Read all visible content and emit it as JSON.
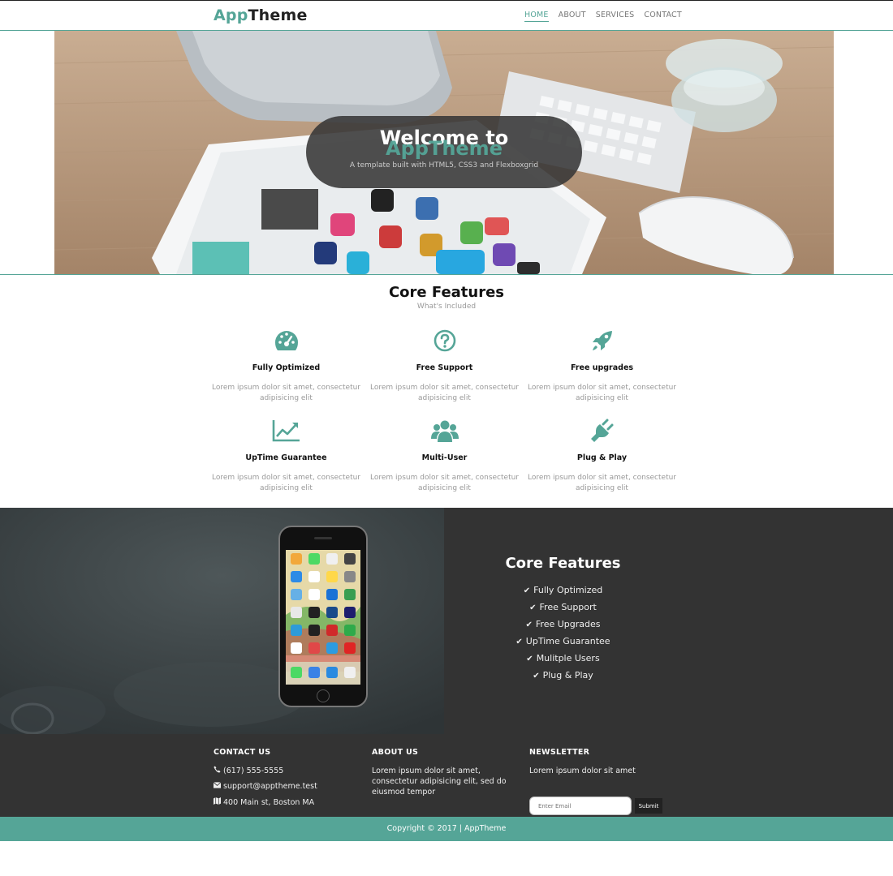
{
  "brand": {
    "accent": "App",
    "rest": "Theme",
    "accent_color": "#55a597"
  },
  "nav": [
    {
      "label": "HOME",
      "active": true
    },
    {
      "label": "ABOUT",
      "active": false
    },
    {
      "label": "SERVICES",
      "active": false
    },
    {
      "label": "CONTACT",
      "active": false
    }
  ],
  "hero": {
    "title_line1": "Welcome to",
    "title_line2": "AppTheme",
    "subtitle": "A template built with HTML5, CSS3 and Flexboxgrid"
  },
  "core_features": {
    "title": "Core Features",
    "subtitle": "What's Included",
    "items": [
      {
        "icon": "dashboard-icon",
        "name": "Fully Optimized",
        "desc": "Lorem ipsum dolor sit amet, consectetur adipisicing elit"
      },
      {
        "icon": "question-circle-icon",
        "name": "Free Support",
        "desc": "Lorem ipsum dolor sit amet, consectetur adipisicing elit"
      },
      {
        "icon": "rocket-icon",
        "name": "Free upgrades",
        "desc": "Lorem ipsum dolor sit amet, consectetur adipisicing elit"
      },
      {
        "icon": "line-chart-icon",
        "name": "UpTime Guarantee",
        "desc": "Lorem ipsum dolor sit amet, consectetur adipisicing elit"
      },
      {
        "icon": "users-icon",
        "name": "Multi-User",
        "desc": "Lorem ipsum dolor sit amet, consectetur adipisicing elit"
      },
      {
        "icon": "plug-icon",
        "name": "Plug & Play",
        "desc": "Lorem ipsum dolor sit amet, consectetur adipisicing elit"
      }
    ]
  },
  "dark_section": {
    "title": "Core Features",
    "items": [
      "Fully Optimized",
      "Free Support",
      "Free Upgrades",
      "UpTime Guarantee",
      "Mulitple Users",
      "Plug & Play"
    ]
  },
  "footer": {
    "contact": {
      "heading": "CONTACT US",
      "phone": "(617) 555-5555",
      "email": "support@apptheme.test",
      "address": "400 Main st, Boston MA"
    },
    "about": {
      "heading": "ABOUT US",
      "text": "Lorem ipsum dolor sit amet, consectetur adipisicing elit, sed do eiusmod tempor"
    },
    "newsletter": {
      "heading": "NEWSLETTER",
      "text": "Lorem ipsum dolor sit amet",
      "placeholder": "Enter Email",
      "submit_label": "Submit"
    },
    "copyright": "Copyright © 2017 | AppTheme"
  }
}
